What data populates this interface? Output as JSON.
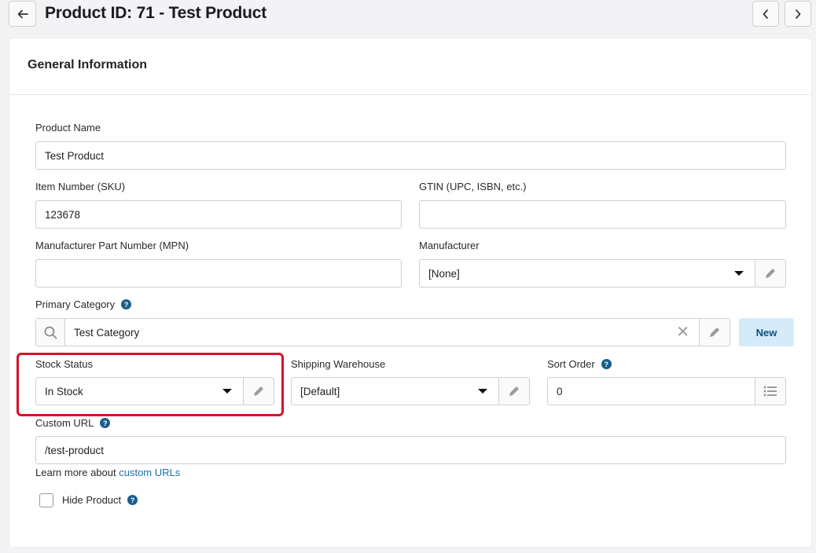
{
  "header": {
    "title": "Product ID: 71 - Test Product",
    "back_icon": "arrow-left-icon",
    "prev_icon": "chevron-left-icon",
    "next_icon": "chevron-right-icon"
  },
  "card": {
    "title": "General Information"
  },
  "fields": {
    "product_name": {
      "label": "Product Name",
      "value": "Test Product"
    },
    "sku": {
      "label": "Item Number (SKU)",
      "value": "123678"
    },
    "gtin": {
      "label": "GTIN (UPC, ISBN, etc.)",
      "value": ""
    },
    "mpn": {
      "label": "Manufacturer Part Number (MPN)",
      "value": ""
    },
    "manufacturer": {
      "label": "Manufacturer",
      "value": "[None]"
    },
    "primary_category": {
      "label": "Primary Category",
      "value": "Test Category",
      "new_label": "New"
    },
    "stock_status": {
      "label": "Stock Status",
      "value": "In Stock"
    },
    "shipping_warehouse": {
      "label": "Shipping Warehouse",
      "value": "[Default]"
    },
    "sort_order": {
      "label": "Sort Order",
      "value": "0"
    },
    "custom_url": {
      "label": "Custom URL",
      "value": "/test-product",
      "learn_prefix": "Learn more about ",
      "learn_link": "custom URLs"
    },
    "hide_product": {
      "label": "Hide Product",
      "checked": false
    }
  },
  "help_glyph": "?",
  "clear_glyph": "✕",
  "colors": {
    "accent": "#1d6fa5",
    "help_badge": "#1b5e8a",
    "new_button_bg": "#d6ebfa",
    "highlight": "#d8112a"
  }
}
